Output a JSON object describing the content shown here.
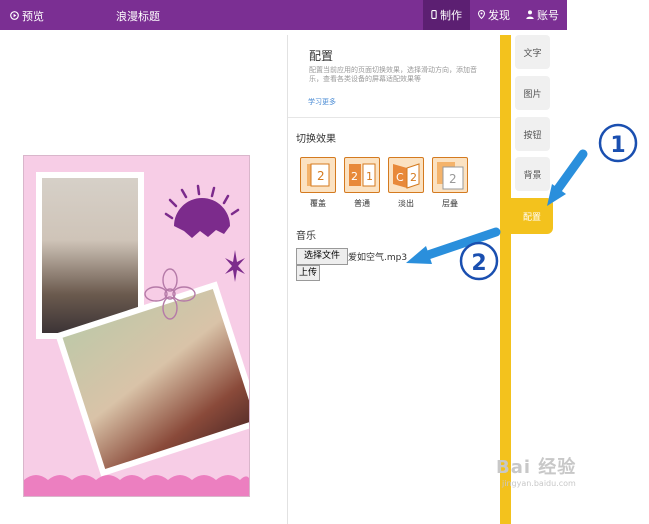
{
  "topbar": {
    "preview_label": "预览",
    "title": "浪漫标题",
    "items": [
      {
        "label": "制作",
        "active": true
      },
      {
        "label": "发现",
        "active": false
      },
      {
        "label": "账号",
        "active": false
      }
    ]
  },
  "config_panel": {
    "title": "配置",
    "description": "配置当前应用的页面切换效果，选择滑动方向，添加音乐，查看各类设备的屏幕适配效果等",
    "more_link": "学习更多",
    "transition_label": "切换效果",
    "effects": [
      "覆盖",
      "普通",
      "淡出",
      "层叠"
    ],
    "music_label": "音乐",
    "choose_file_label": "选择文件",
    "file_name": "爱如空气.mp3",
    "upload_label": "上传"
  },
  "side_tabs": [
    {
      "label": "文字",
      "active": false
    },
    {
      "label": "图片",
      "active": false
    },
    {
      "label": "按钮",
      "active": false
    },
    {
      "label": "背景",
      "active": false
    },
    {
      "label": "配置",
      "active": true
    }
  ],
  "annotations": {
    "one": "1",
    "two": "2"
  },
  "watermark": {
    "main": "Bai 经验",
    "sub": "jingyan.baidu.com"
  },
  "colors": {
    "topbar": "#7b2f93",
    "accent": "#f3c21d",
    "arrow": "#2a8fdc",
    "effect_border": "#d47a1f"
  }
}
